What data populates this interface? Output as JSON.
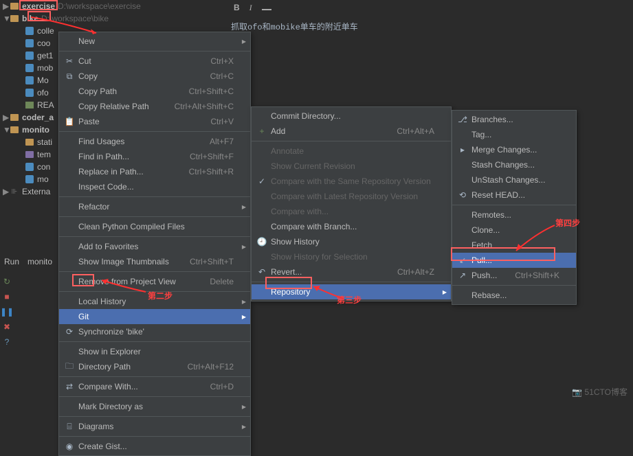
{
  "tree": {
    "exercise": {
      "label": "exercise",
      "path": "D:\\workspace\\exercise"
    },
    "bike": {
      "label": "bike",
      "path": "D:\\workspace\\bike"
    },
    "items": [
      "colle",
      "coo",
      "get1",
      "mob",
      "Mo",
      "ofo",
      "REA"
    ],
    "coder": "coder_a",
    "monito": "monito",
    "monito_items": [
      "stati",
      "tem",
      "con",
      "mo"
    ],
    "externa": "Externa"
  },
  "toolbar": {
    "bold": "B",
    "italic": "I"
  },
  "editor": {
    "line": "抓取ofo和mobike单车的附近单车"
  },
  "run_tab": {
    "label": "Run",
    "file": "monito"
  },
  "menu1": {
    "new": "New",
    "cut": "Cut",
    "cut_s": "Ctrl+X",
    "copy": "Copy",
    "copy_s": "Ctrl+C",
    "copy_path": "Copy Path",
    "copy_path_s": "Ctrl+Shift+C",
    "copy_rel": "Copy Relative Path",
    "copy_rel_s": "Ctrl+Alt+Shift+C",
    "paste": "Paste",
    "paste_s": "Ctrl+V",
    "find_usages": "Find Usages",
    "find_usages_s": "Alt+F7",
    "find_in_path": "Find in Path...",
    "find_in_path_s": "Ctrl+Shift+F",
    "replace_in_path": "Replace in Path...",
    "replace_in_path_s": "Ctrl+Shift+R",
    "inspect": "Inspect Code...",
    "refactor": "Refactor",
    "clean": "Clean Python Compiled Files",
    "add_fav": "Add to Favorites",
    "show_thumb": "Show Image Thumbnails",
    "show_thumb_s": "Ctrl+Shift+T",
    "remove": "Remove from Project View",
    "remove_s": "Delete",
    "local_history": "Local History",
    "git": "Git",
    "sync": "Synchronize 'bike'",
    "explorer": "Show in Explorer",
    "dir_path": "Directory Path",
    "dir_path_s": "Ctrl+Alt+F12",
    "compare": "Compare With...",
    "compare_s": "Ctrl+D",
    "mark_dir": "Mark Directory as",
    "diagrams": "Diagrams",
    "gist": "Create Gist..."
  },
  "menu2": {
    "commit_dir": "Commit Directory...",
    "add": "Add",
    "add_s": "Ctrl+Alt+A",
    "annotate": "Annotate",
    "show_rev": "Show Current Revision",
    "cmp_same": "Compare with the Same Repository Version",
    "cmp_latest": "Compare with Latest Repository Version",
    "cmp_with": "Compare with...",
    "cmp_branch": "Compare with Branch...",
    "history": "Show History",
    "history_sel": "Show History for Selection",
    "revert": "Revert...",
    "revert_s": "Ctrl+Alt+Z",
    "repository": "Repository"
  },
  "menu3": {
    "branches": "Branches...",
    "tag": "Tag...",
    "merge": "Merge Changes...",
    "stash": "Stash Changes...",
    "unstash": "UnStash Changes...",
    "reset": "Reset HEAD...",
    "remotes": "Remotes...",
    "clone": "Clone...",
    "fetch": "Fetch",
    "pull": "Pull...",
    "push": "Push...",
    "push_s": "Ctrl+Shift+K",
    "rebase": "Rebase..."
  },
  "annotations": {
    "step2": "第二步",
    "step3": "第三步",
    "step4": "第四步"
  },
  "watermark": "51CTO博客"
}
